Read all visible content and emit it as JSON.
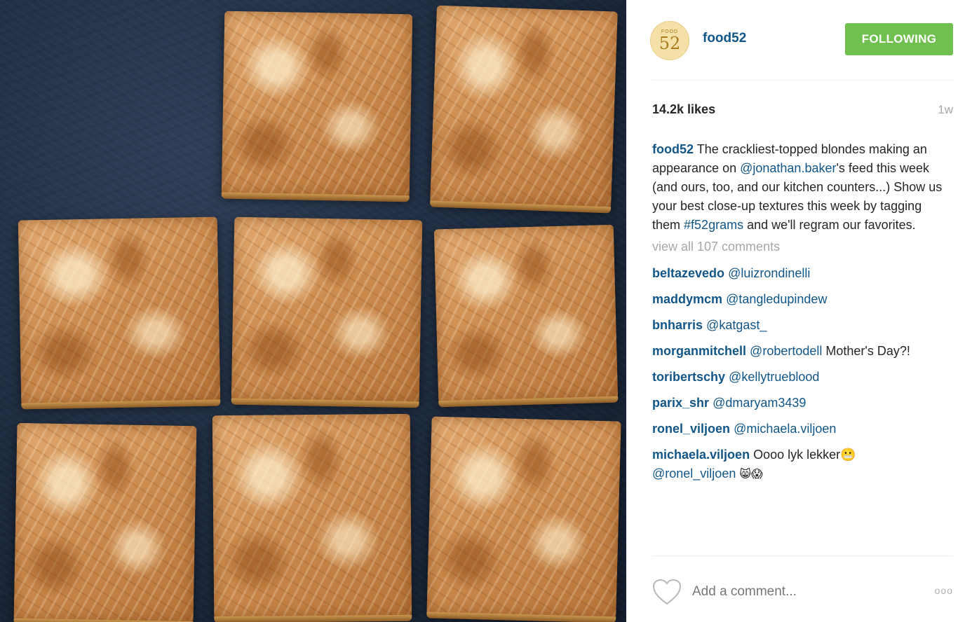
{
  "post": {
    "username": "food52",
    "avatar_text_small": "FOOD",
    "avatar_text_big": "52",
    "follow_label": "FOLLOWING",
    "likes": "14.2k likes",
    "time": "1w",
    "caption": {
      "user": "food52",
      "part1": " The crackliest-topped blondes making an appearance on ",
      "mention": "@jonathan.baker",
      "part2": "'s feed this week (and ours, too, and our kitchen counters...) Show us your best close-up textures this week by tagging them ",
      "hashtag": "#f52grams",
      "part3": " and we'll regram our favorites."
    },
    "view_all_comments": "view all 107 comments",
    "comments": [
      {
        "user": "beltazevedo",
        "mention": "@luizrondinelli",
        "text": "",
        "mention2": "",
        "emoji": ""
      },
      {
        "user": "maddymcm",
        "mention": "@tangledupindew",
        "text": "",
        "mention2": "",
        "emoji": ""
      },
      {
        "user": "bnharris",
        "mention": "@katgast_",
        "text": "",
        "mention2": "",
        "emoji": ""
      },
      {
        "user": "morganmitchell",
        "mention": "@robertodell",
        "text": " Mother's Day?!",
        "mention2": "",
        "emoji": ""
      },
      {
        "user": "toribertschy",
        "mention": "@kellytrueblood",
        "text": "",
        "mention2": "",
        "emoji": ""
      },
      {
        "user": "parix_shr",
        "mention": "@dmaryam3439",
        "text": "",
        "mention2": "",
        "emoji": ""
      },
      {
        "user": "ronel_viljoen",
        "mention": "@michaela.viljoen",
        "text": "",
        "mention2": "",
        "emoji": ""
      },
      {
        "user": "michaela.viljoen",
        "mention": "",
        "text": " Oooo lyk lekker😬",
        "mention2": "@ronel_viljoen",
        "emoji": "😸😱"
      }
    ],
    "add_comment_placeholder": "Add a comment...",
    "more_label": "ooo"
  },
  "colors": {
    "link": "#125688",
    "follow_bg": "#70c050",
    "muted": "#a5a7aa"
  },
  "icons": {
    "like": "heart-outline-icon",
    "more": "ellipsis-icon"
  },
  "photo": {
    "subject": "photo-of-blondie-bars"
  }
}
